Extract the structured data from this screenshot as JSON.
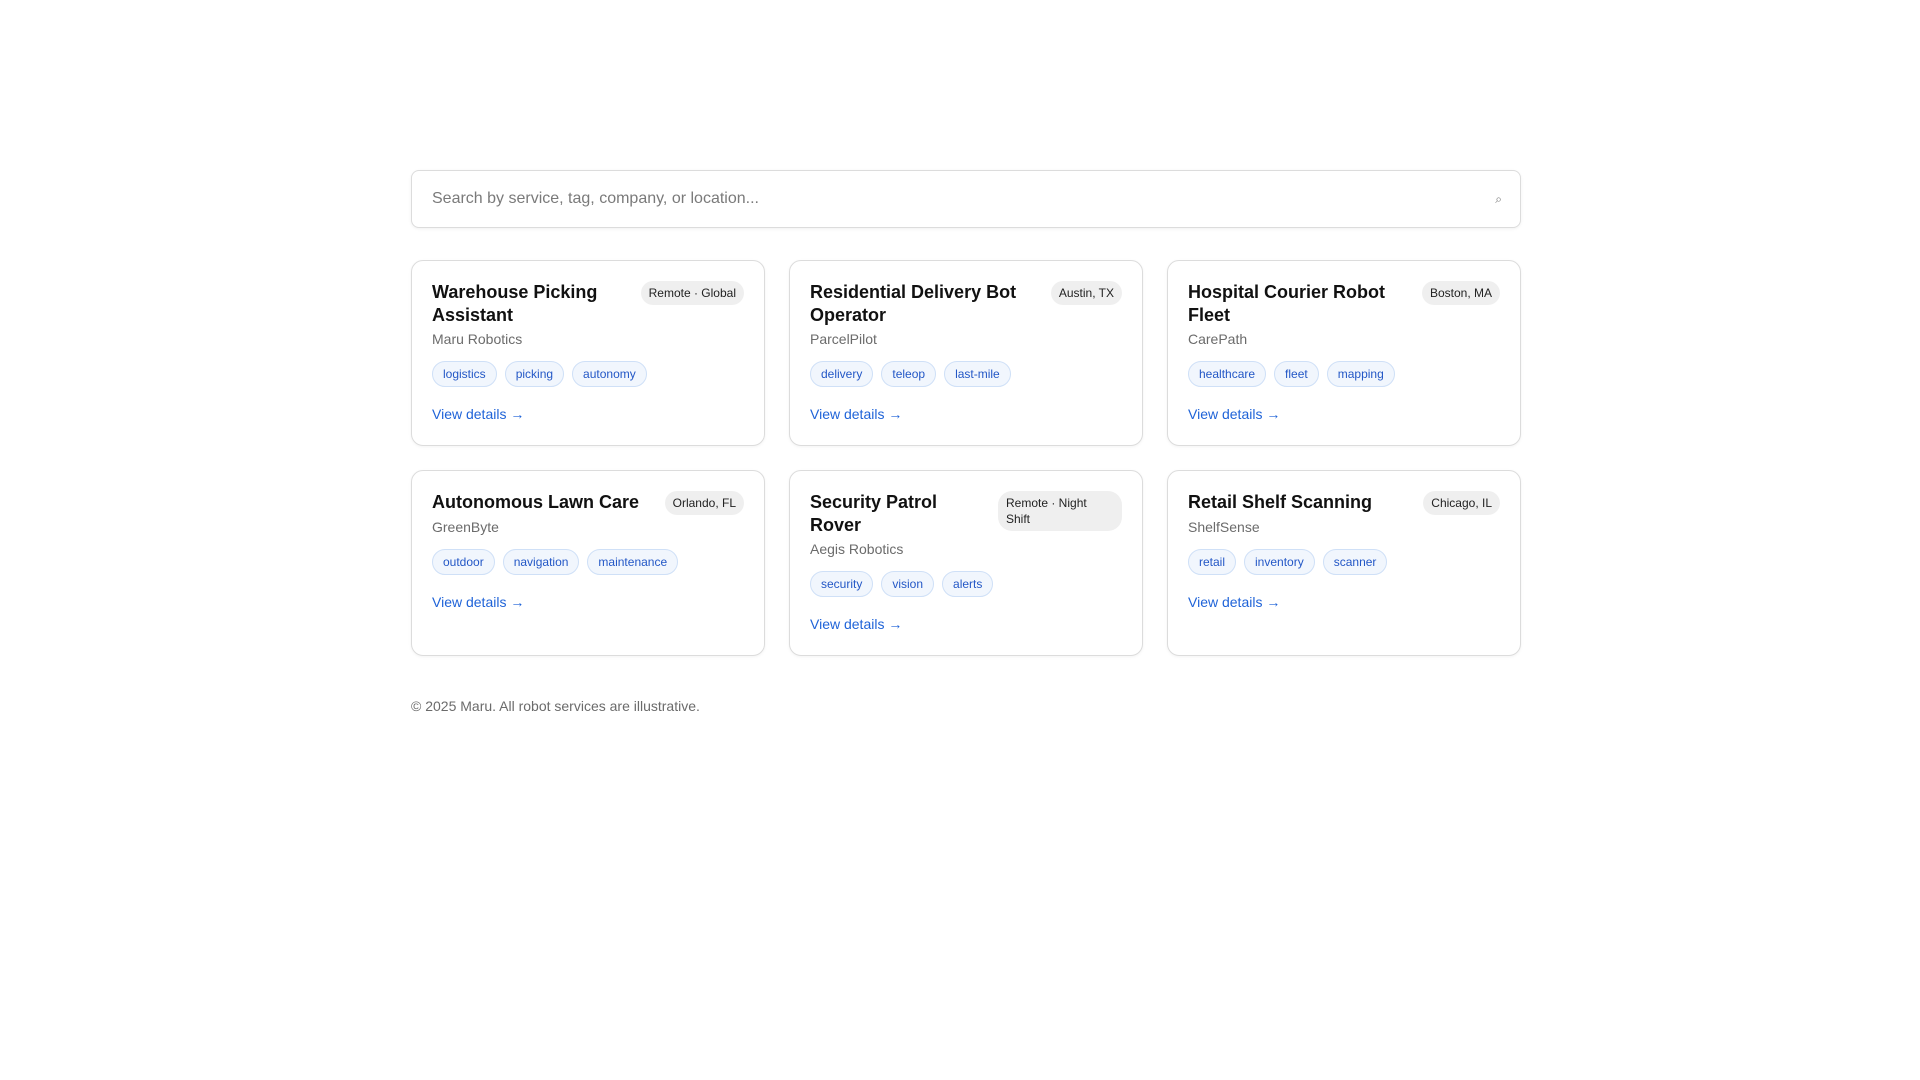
{
  "search": {
    "placeholder": "Search by service, tag, company, or location...",
    "value": "",
    "icon": "search-icon",
    "icon_glyph": "⌕"
  },
  "cards": [
    {
      "title": "Warehouse Picking Assistant",
      "company": "Maru Robotics",
      "location": "Remote · Global",
      "tags": [
        "logistics",
        "picking",
        "autonomy"
      ],
      "link": "View details →"
    },
    {
      "title": "Residential Delivery Bot Operator",
      "company": "ParcelPilot",
      "location": "Austin, TX",
      "tags": [
        "delivery",
        "teleop",
        "last-mile"
      ],
      "link": "View details →"
    },
    {
      "title": "Hospital Courier Robot Fleet",
      "company": "CarePath",
      "location": "Boston, MA",
      "tags": [
        "healthcare",
        "fleet",
        "mapping"
      ],
      "link": "View details →"
    },
    {
      "title": "Autonomous Lawn Care",
      "company": "GreenByte",
      "location": "Orlando, FL",
      "tags": [
        "outdoor",
        "navigation",
        "maintenance"
      ],
      "link": "View details →"
    },
    {
      "title": "Security Patrol Rover",
      "company": "Aegis Robotics",
      "location": "Remote · Night Shift",
      "tags": [
        "security",
        "vision",
        "alerts"
      ],
      "link": "View details →"
    },
    {
      "title": "Retail Shelf Scanning",
      "company": "ShelfSense",
      "location": "Chicago, IL",
      "tags": [
        "retail",
        "inventory",
        "scanner"
      ],
      "link": "View details →"
    }
  ],
  "footer": {
    "text": "© 2025 Maru. All robot services are illustrative."
  },
  "colors": {
    "link": "#1f63d8",
    "tag_text": "#2357c6",
    "tag_bg": "#f1f6fd",
    "badge_bg": "#efefef",
    "border": "#dcdcdc"
  }
}
